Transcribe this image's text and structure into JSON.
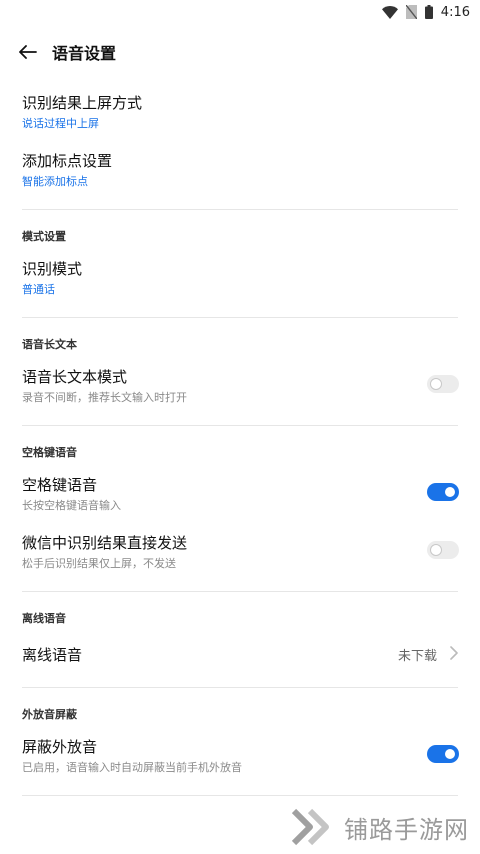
{
  "status_bar": {
    "time": "4:16"
  },
  "app_bar": {
    "title": "语音设置"
  },
  "rows": {
    "commit_mode": {
      "title": "识别结果上屏方式",
      "value": "说话过程中上屏"
    },
    "punctuation": {
      "title": "添加标点设置",
      "value": "智能添加标点"
    },
    "recognition_mode": {
      "title": "识别模式",
      "value": "普通话"
    },
    "long_text_mode": {
      "title": "语音长文本模式",
      "desc": "录音不间断，推荐长文输入时打开",
      "enabled": false
    },
    "space_voice": {
      "title": "空格键语音",
      "desc": "长按空格键语音输入",
      "enabled": true
    },
    "wechat_direct_send": {
      "title": "微信中识别结果直接发送",
      "desc": "松手后识别结果仅上屏，不发送",
      "enabled": false
    },
    "offline_voice": {
      "title": "离线语音",
      "value": "未下载"
    },
    "mute_speaker": {
      "title": "屏蔽外放音",
      "desc": "已启用，语音输入时自动屏蔽当前手机外放音",
      "enabled": true
    }
  },
  "sections": {
    "mode": "模式设置",
    "long_text": "语音长文本",
    "space": "空格键语音",
    "offline": "离线语音",
    "speaker_block": "外放音屏蔽"
  },
  "watermark": {
    "text": "铺路手游网"
  },
  "colors": {
    "accent": "#1a73e8",
    "divider": "#e6e6e6",
    "muted_text": "#8a8a8a"
  }
}
